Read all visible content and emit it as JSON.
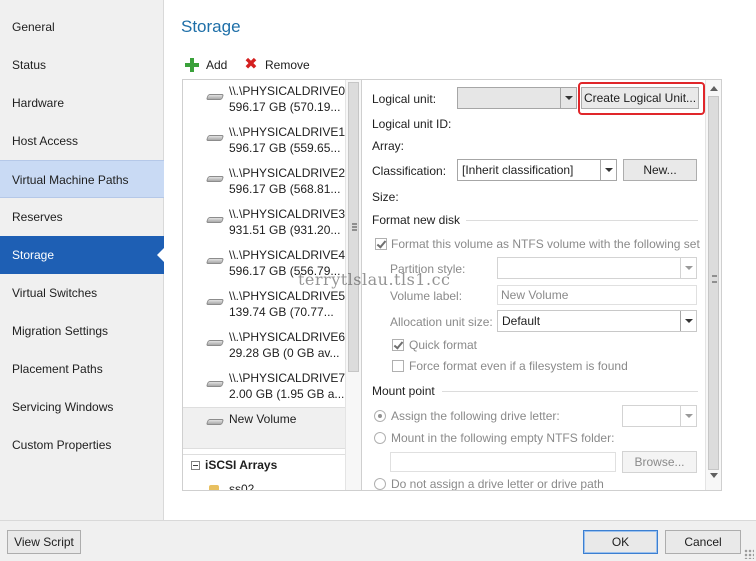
{
  "nav": {
    "items": [
      {
        "label": "General"
      },
      {
        "label": "Status"
      },
      {
        "label": "Hardware"
      },
      {
        "label": "Host Access"
      },
      {
        "label": "Virtual Machine Paths"
      },
      {
        "label": "Reserves"
      },
      {
        "label": "Storage"
      },
      {
        "label": "Virtual Switches"
      },
      {
        "label": "Migration Settings"
      },
      {
        "label": "Placement Paths"
      },
      {
        "label": "Servicing Windows"
      },
      {
        "label": "Custom Properties"
      }
    ],
    "selected": "Storage",
    "hovered": "Virtual Machine Paths"
  },
  "page": {
    "title": "Storage"
  },
  "toolbar": {
    "add_label": "Add",
    "remove_label": "Remove"
  },
  "drives": [
    {
      "name": "\\\\.\\PHYSICALDRIVE0",
      "size": "596.17 GB (570.19..."
    },
    {
      "name": "\\\\.\\PHYSICALDRIVE1",
      "size": "596.17 GB (559.65..."
    },
    {
      "name": "\\\\.\\PHYSICALDRIVE2",
      "size": "596.17 GB (568.81..."
    },
    {
      "name": "\\\\.\\PHYSICALDRIVE3",
      "size": "931.51 GB (931.20..."
    },
    {
      "name": "\\\\.\\PHYSICALDRIVE4",
      "size": "596.17 GB (556.79..."
    },
    {
      "name": "\\\\.\\PHYSICALDRIVE5",
      "size": "139.74 GB (70.77..."
    },
    {
      "name": "\\\\.\\PHYSICALDRIVE6",
      "size": "29.28 GB (0 GB av..."
    },
    {
      "name": "\\\\.\\PHYSICALDRIVE7",
      "size": "2.00 GB (1.95 GB a..."
    },
    {
      "name": "New Volume",
      "size": ""
    }
  ],
  "iscsi": {
    "header": "iSCSI Arrays",
    "item": "ss02"
  },
  "props": {
    "logical_unit_label": "Logical unit:",
    "logical_unit_value": "",
    "create_lu_button": "Create Logical Unit...",
    "logical_unit_id_label": "Logical unit ID:",
    "array_label": "Array:",
    "classification_label": "Classification:",
    "classification_value": "[Inherit classification]",
    "new_button": "New...",
    "size_label": "Size:",
    "format_section": "Format new disk",
    "format_checkbox": "Format this volume as NTFS volume with the following set",
    "partition_style_label": "Partition style:",
    "partition_style_value": "",
    "volume_label_label": "Volume label:",
    "volume_label_value": "New Volume",
    "alloc_unit_label": "Allocation unit size:",
    "alloc_unit_value": "Default",
    "quick_format": "Quick format",
    "force_format": "Force format even if a filesystem is found",
    "mount_section": "Mount point",
    "assign_letter": "Assign the following drive letter:",
    "drive_letter_value": "",
    "mount_folder": "Mount in the following empty NTFS folder:",
    "folder_value": "",
    "browse_button": "Browse...",
    "no_letter": "Do not assign a drive letter or drive path"
  },
  "watermark": "terrytlslau.tls1.cc",
  "footer": {
    "view_script": "View Script",
    "ok": "OK",
    "cancel": "Cancel"
  },
  "colors": {
    "nav_selected": "#1e5fb4",
    "nav_hover": "#c9daf4",
    "title": "#1e6fa8",
    "highlight": "#e0262a"
  }
}
